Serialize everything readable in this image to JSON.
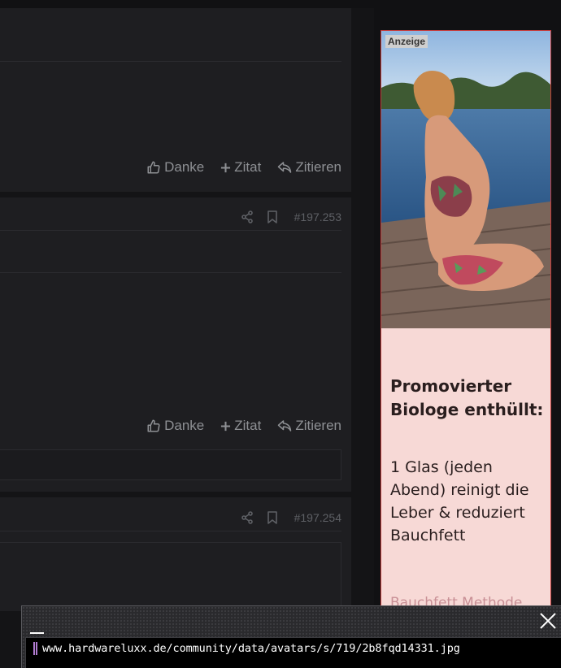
{
  "actions": {
    "danke": "Danke",
    "zitat": "Zitat",
    "zitieren": "Zitieren"
  },
  "posts": [
    {
      "number": ""
    },
    {
      "number": "#197.253"
    },
    {
      "number": "#197.254"
    }
  ],
  "ad": {
    "label": "Anzeige",
    "headline": "Promovierter Biologe enthüllt:",
    "body": "1 Glas (jeden Abend) reinigt die Leber & reduziert Bauchfett",
    "cta": "Bauchfett Methode"
  },
  "urlbar": {
    "url": "www.hardwareluxx.de/community/data/avatars/s/719/2b8fqd14331.jpg"
  },
  "colors": {
    "background": "#141416",
    "post_bg": "#1e1e21",
    "ad_bg": "#f7d9d6",
    "ad_border": "#c43a3a",
    "caret": "#b07bd0"
  }
}
